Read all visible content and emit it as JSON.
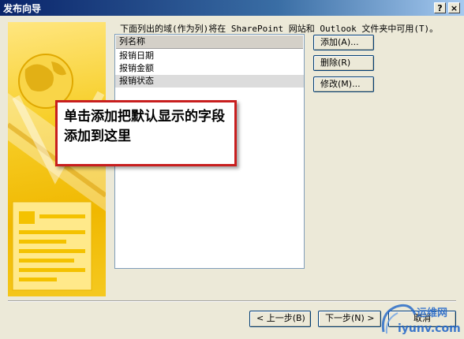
{
  "window": {
    "title": "发布向导",
    "help_btn": "?",
    "close_btn": "×"
  },
  "instruction": "下面列出的域(作为列)将在 SharePoint 网站和 Outlook 文件夹中可用(T)。",
  "list": {
    "header": "列名称",
    "items": [
      "报销日期",
      "报销金额",
      "报销状态"
    ],
    "selected_index": 2
  },
  "buttons": {
    "add": "添加(A)...",
    "delete": "删除(R)",
    "modify": "修改(M)..."
  },
  "nav": {
    "back": "< 上一步(B)",
    "next": "下一步(N) >",
    "cancel": "取消"
  },
  "callout": "单击添加把默认显示的字段添加到这里",
  "watermark": {
    "text_cn": "运维网",
    "text_en": "iyunv.com"
  },
  "colors": {
    "title_bar_start": "#0a246a",
    "title_bar_end": "#a6caf0",
    "dialog_bg": "#ece9d8",
    "banner_yellow": "#f7cf2a",
    "callout_border": "#c81e1e",
    "watermark_blue": "#1e64c8"
  }
}
